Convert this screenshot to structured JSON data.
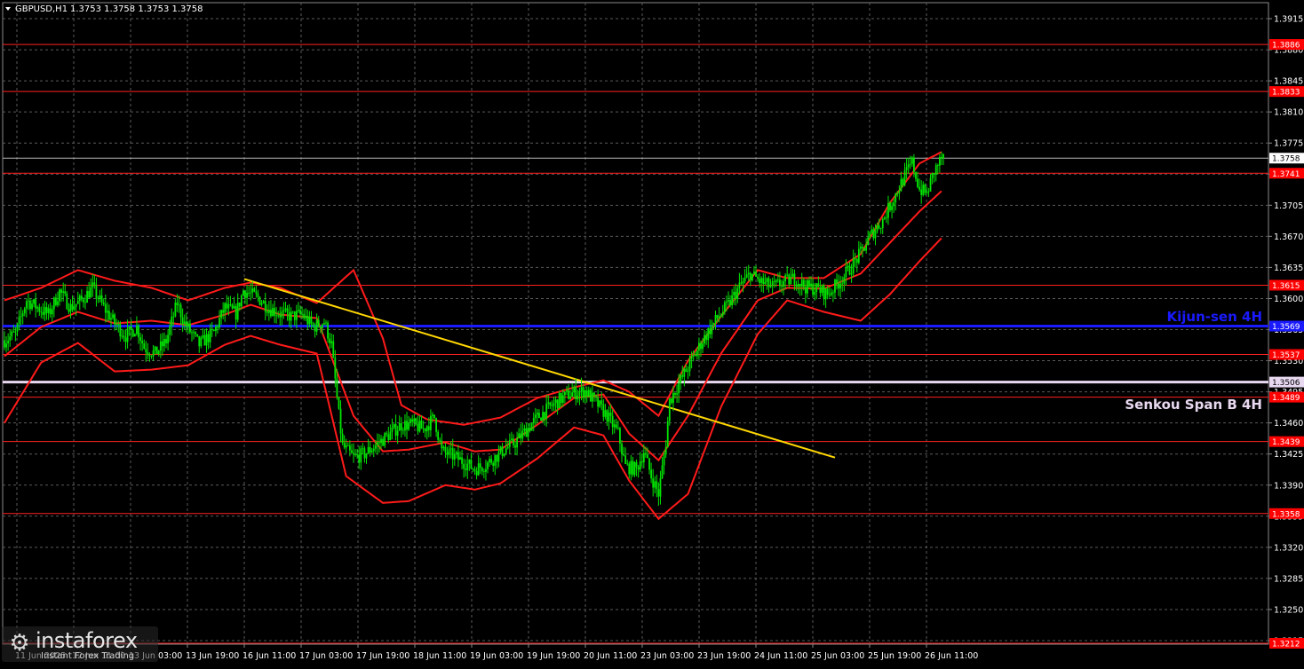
{
  "header": {
    "symbol": "GBPUSD,H1",
    "ohlc": "1.3753 1.3758 1.3753 1.3758"
  },
  "colors": {
    "background": "#000000",
    "grid": "#5a5a5a",
    "candle": "#00e600",
    "bollinger": "#ff1a1a",
    "level": "#ff2020",
    "kijun": "#1a1aff",
    "senkou": "#e8d8f0",
    "trend": "#ffd700",
    "axis_text": "#ffffff"
  },
  "labels": {
    "kijun": "Kijun-sen 4H",
    "senkou": "Senkou Span B 4H"
  },
  "logo": {
    "name": "instaforex",
    "tagline": "Instant Forex Trading"
  },
  "chart_data": {
    "type": "candlestick",
    "symbol": "GBPUSD",
    "timeframe": "H1",
    "ylim": [
      1.3211,
      1.3933
    ],
    "y_ticks": [
      1.3915,
      1.388,
      1.3845,
      1.381,
      1.3775,
      1.374,
      1.3705,
      1.367,
      1.3635,
      1.36,
      1.3565,
      1.353,
      1.3495,
      1.346,
      1.3425,
      1.339,
      1.3355,
      1.332,
      1.3285,
      1.325,
      1.3215
    ],
    "x_ticks": [
      "11 Jun 2025",
      "12 Jun 11:00",
      "13 Jun 03:00",
      "13 Jun 19:00",
      "16 Jun 11:00",
      "17 Jun 03:00",
      "17 Jun 19:00",
      "18 Jun 11:00",
      "19 Jun 03:00",
      "19 Jun 19:00",
      "20 Jun 11:00",
      "23 Jun 03:00",
      "23 Jun 19:00",
      "24 Jun 11:00",
      "25 Jun 03:00",
      "25 Jun 19:00",
      "26 Jun 11:00"
    ],
    "current_price": 1.3758,
    "levels": [
      {
        "name": "resistance",
        "value": 1.3886,
        "label": "1.3886"
      },
      {
        "name": "resistance",
        "value": 1.3833,
        "label": "1.3833"
      },
      {
        "name": "resistance",
        "value": 1.3741,
        "label": "1.3741"
      },
      {
        "name": "resistance",
        "value": 1.3615,
        "label": "1.3615"
      },
      {
        "name": "kijun",
        "value": 1.3569,
        "label": "1.3569"
      },
      {
        "name": "support",
        "value": 1.3537,
        "label": "1.3537"
      },
      {
        "name": "senkou",
        "value": 1.3506,
        "label": "1.3506"
      },
      {
        "name": "support",
        "value": 1.3489,
        "label": "1.3489"
      },
      {
        "name": "support",
        "value": 1.3439,
        "label": "1.3439"
      },
      {
        "name": "support",
        "value": 1.3358,
        "label": "1.3358"
      },
      {
        "name": "support",
        "value": 1.3212,
        "label": "1.3212"
      }
    ],
    "trendline": {
      "from": {
        "x": "16 Jun 11:00",
        "y": 1.3622
      },
      "to": {
        "x": "24 Jun 03:00",
        "y": 1.3421
      }
    },
    "series_path": [
      [
        0,
        1.3553
      ],
      [
        6,
        1.356
      ],
      [
        12,
        1.3598
      ],
      [
        18,
        1.359
      ],
      [
        24,
        1.3582
      ],
      [
        30,
        1.3608
      ],
      [
        36,
        1.359
      ],
      [
        42,
        1.3598
      ],
      [
        48,
        1.3612
      ],
      [
        54,
        1.359
      ],
      [
        60,
        1.3572
      ],
      [
        66,
        1.3558
      ],
      [
        72,
        1.3568
      ],
      [
        76,
        1.3545
      ],
      [
        82,
        1.3538
      ],
      [
        88,
        1.3552
      ],
      [
        94,
        1.3595
      ],
      [
        98,
        1.3572
      ],
      [
        106,
        1.3548
      ],
      [
        114,
        1.3562
      ],
      [
        120,
        1.359
      ],
      [
        126,
        1.3583
      ],
      [
        130,
        1.3609
      ],
      [
        138,
        1.3601
      ],
      [
        144,
        1.3589
      ],
      [
        150,
        1.3583
      ],
      [
        156,
        1.358
      ],
      [
        162,
        1.3582
      ],
      [
        168,
        1.3568
      ],
      [
        174,
        1.3574
      ],
      [
        178,
        1.3548
      ],
      [
        182,
        1.3468
      ],
      [
        184,
        1.3434
      ],
      [
        190,
        1.3421
      ],
      [
        196,
        1.3425
      ],
      [
        204,
        1.3438
      ],
      [
        210,
        1.3448
      ],
      [
        216,
        1.3458
      ],
      [
        222,
        1.3458
      ],
      [
        228,
        1.3453
      ],
      [
        234,
        1.3466
      ],
      [
        238,
        1.3428
      ],
      [
        244,
        1.3423
      ],
      [
        250,
        1.3416
      ],
      [
        256,
        1.3408
      ],
      [
        262,
        1.3413
      ],
      [
        268,
        1.3423
      ],
      [
        272,
        1.343
      ],
      [
        278,
        1.3438
      ],
      [
        284,
        1.3452
      ],
      [
        290,
        1.3466
      ],
      [
        296,
        1.3476
      ],
      [
        302,
        1.3486
      ],
      [
        308,
        1.3493
      ],
      [
        316,
        1.3496
      ],
      [
        322,
        1.3483
      ],
      [
        328,
        1.3468
      ],
      [
        334,
        1.3448
      ],
      [
        338,
        1.3411
      ],
      [
        344,
        1.3408
      ],
      [
        348,
        1.3428
      ],
      [
        352,
        1.34
      ],
      [
        356,
        1.338
      ],
      [
        360,
        1.3438
      ],
      [
        362,
        1.3485
      ],
      [
        368,
        1.3508
      ],
      [
        374,
        1.353
      ],
      [
        380,
        1.3553
      ],
      [
        388,
        1.3578
      ],
      [
        394,
        1.3593
      ],
      [
        400,
        1.3613
      ],
      [
        406,
        1.3628
      ],
      [
        412,
        1.3618
      ],
      [
        418,
        1.3613
      ],
      [
        424,
        1.3618
      ],
      [
        430,
        1.3623
      ],
      [
        436,
        1.3613
      ],
      [
        442,
        1.3611
      ],
      [
        448,
        1.3605
      ],
      [
        454,
        1.3618
      ],
      [
        460,
        1.3633
      ],
      [
        466,
        1.3651
      ],
      [
        472,
        1.3673
      ],
      [
        478,
        1.3688
      ],
      [
        484,
        1.3713
      ],
      [
        490,
        1.3738
      ],
      [
        494,
        1.3753
      ],
      [
        498,
        1.3723
      ],
      [
        502,
        1.3718
      ],
      [
        506,
        1.3743
      ],
      [
        510,
        1.3758
      ]
    ],
    "bollinger": {
      "upper": [
        [
          0,
          1.3598
        ],
        [
          20,
          1.3612
        ],
        [
          40,
          1.3632
        ],
        [
          60,
          1.362
        ],
        [
          80,
          1.3612
        ],
        [
          100,
          1.3598
        ],
        [
          120,
          1.3612
        ],
        [
          134,
          1.3618
        ],
        [
          150,
          1.3612
        ],
        [
          170,
          1.3595
        ],
        [
          190,
          1.3632
        ],
        [
          206,
          1.3555
        ],
        [
          216,
          1.348
        ],
        [
          230,
          1.3464
        ],
        [
          250,
          1.3458
        ],
        [
          270,
          1.3466
        ],
        [
          290,
          1.3488
        ],
        [
          310,
          1.35
        ],
        [
          326,
          1.3508
        ],
        [
          340,
          1.3495
        ],
        [
          356,
          1.3468
        ],
        [
          372,
          1.353
        ],
        [
          390,
          1.358
        ],
        [
          410,
          1.3632
        ],
        [
          426,
          1.3623
        ],
        [
          446,
          1.3623
        ],
        [
          466,
          1.365
        ],
        [
          482,
          1.3708
        ],
        [
          498,
          1.3752
        ],
        [
          510,
          1.3765
        ]
      ],
      "middle": [
        [
          0,
          1.3535
        ],
        [
          20,
          1.3568
        ],
        [
          40,
          1.3585
        ],
        [
          60,
          1.3572
        ],
        [
          80,
          1.3575
        ],
        [
          100,
          1.357
        ],
        [
          120,
          1.3582
        ],
        [
          134,
          1.3593
        ],
        [
          150,
          1.3582
        ],
        [
          170,
          1.3578
        ],
        [
          190,
          1.3468
        ],
        [
          206,
          1.3428
        ],
        [
          220,
          1.343
        ],
        [
          240,
          1.3438
        ],
        [
          256,
          1.3428
        ],
        [
          270,
          1.343
        ],
        [
          290,
          1.3458
        ],
        [
          310,
          1.3488
        ],
        [
          326,
          1.3492
        ],
        [
          340,
          1.3448
        ],
        [
          356,
          1.3418
        ],
        [
          372,
          1.3468
        ],
        [
          390,
          1.3538
        ],
        [
          410,
          1.3598
        ],
        [
          426,
          1.3612
        ],
        [
          446,
          1.3611
        ],
        [
          466,
          1.3628
        ],
        [
          482,
          1.3663
        ],
        [
          498,
          1.3698
        ],
        [
          510,
          1.3721
        ]
      ],
      "lower": [
        [
          0,
          1.346
        ],
        [
          20,
          1.3528
        ],
        [
          40,
          1.355
        ],
        [
          60,
          1.3518
        ],
        [
          80,
          1.352
        ],
        [
          100,
          1.3525
        ],
        [
          120,
          1.3548
        ],
        [
          134,
          1.3558
        ],
        [
          150,
          1.3548
        ],
        [
          170,
          1.3538
        ],
        [
          186,
          1.34
        ],
        [
          206,
          1.337
        ],
        [
          220,
          1.3372
        ],
        [
          240,
          1.339
        ],
        [
          256,
          1.3385
        ],
        [
          270,
          1.3392
        ],
        [
          290,
          1.342
        ],
        [
          310,
          1.3455
        ],
        [
          326,
          1.3446
        ],
        [
          340,
          1.3395
        ],
        [
          356,
          1.3352
        ],
        [
          372,
          1.338
        ],
        [
          390,
          1.3478
        ],
        [
          410,
          1.356
        ],
        [
          426,
          1.3598
        ],
        [
          446,
          1.3585
        ],
        [
          466,
          1.3575
        ],
        [
          482,
          1.3605
        ],
        [
          498,
          1.3642
        ],
        [
          510,
          1.3668
        ]
      ]
    }
  }
}
